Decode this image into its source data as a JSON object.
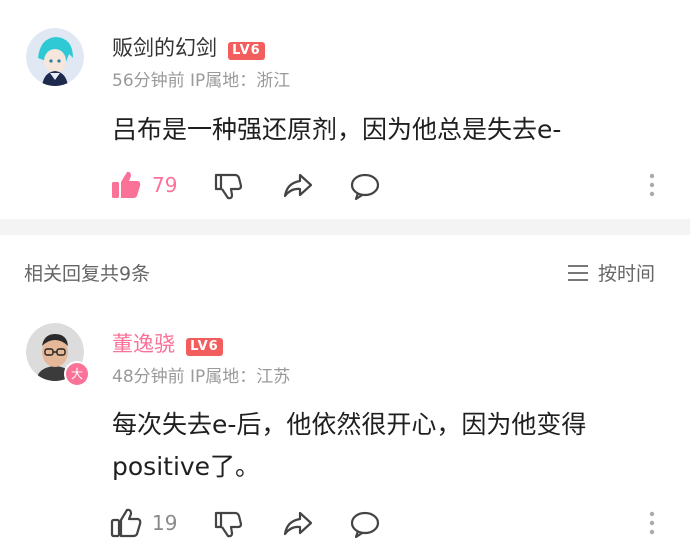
{
  "comment1": {
    "username": "贩剑的幻剑",
    "level": "LV6",
    "meta": "56分钟前 IP属地：浙江",
    "text": "吕布是一种强还原剂，因为他总是失去e-",
    "likes": "79"
  },
  "replies_header": {
    "title": "相关回复共9条",
    "sort_label": "按时间"
  },
  "comment2": {
    "username": "董逸骁",
    "level": "LV6",
    "vip_badge": "大",
    "meta": "48分钟前 IP属地：江苏",
    "text_line1": "每次失去e-后，他依然很开心，因为他变得",
    "text_line2": "positive了。",
    "likes": "19"
  },
  "colors": {
    "accent": "#fb7299",
    "level_badge": "#f25d5d",
    "meta_gray": "#9a9a9a",
    "divider": "#f4f4f4"
  },
  "icons": [
    "thumb-up-icon",
    "thumb-down-icon",
    "share-icon",
    "reply-bubble-icon",
    "more-icon",
    "sort-lines-icon"
  ]
}
